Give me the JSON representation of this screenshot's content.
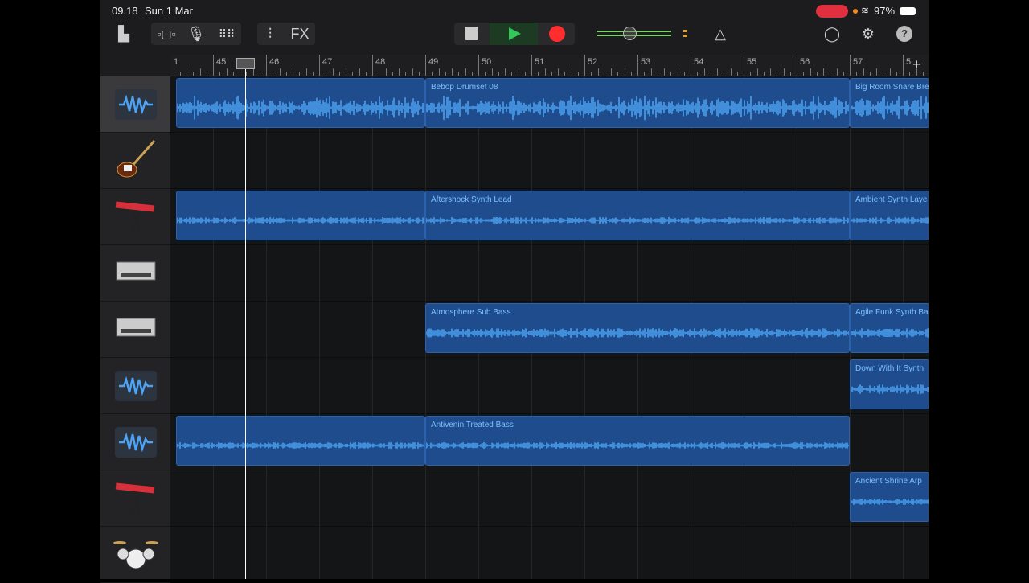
{
  "status": {
    "time": "09.18",
    "date": "Sun 1 Mar",
    "battery": "97%"
  },
  "toolbar": {
    "fx_label": "FX"
  },
  "ruler": {
    "bars": [
      "1",
      "45",
      "46",
      "47",
      "48",
      "49",
      "50",
      "51",
      "52",
      "53",
      "54",
      "55",
      "56",
      "57",
      "5"
    ],
    "add": "+"
  },
  "tracks": [
    {
      "icon": "audio-waveform-icon",
      "selected": true
    },
    {
      "icon": "electric-guitar-icon"
    },
    {
      "icon": "keyboard-icon"
    },
    {
      "icon": "drum-machine-icon"
    },
    {
      "icon": "drum-machine-icon"
    },
    {
      "icon": "audio-waveform-icon"
    },
    {
      "icon": "audio-waveform-icon"
    },
    {
      "icon": "keyboard-icon"
    },
    {
      "icon": "drum-kit-icon"
    }
  ],
  "regions": [
    {
      "track": 0,
      "start": 44.3,
      "end": 49,
      "name": ""
    },
    {
      "track": 0,
      "start": 49,
      "end": 57,
      "name": "Bebop Drumset 08"
    },
    {
      "track": 0,
      "start": 57,
      "end": 58.5,
      "name": "Big Room Snare Bre"
    },
    {
      "track": 2,
      "start": 44.3,
      "end": 49,
      "name": ""
    },
    {
      "track": 2,
      "start": 49,
      "end": 57,
      "name": "Aftershock Synth Lead"
    },
    {
      "track": 2,
      "start": 57,
      "end": 58.5,
      "name": "Ambient Synth Laye"
    },
    {
      "track": 4,
      "start": 49,
      "end": 57,
      "name": "Atmosphere Sub Bass"
    },
    {
      "track": 4,
      "start": 57,
      "end": 58.5,
      "name": "Agile Funk Synth Ba"
    },
    {
      "track": 5,
      "start": 57,
      "end": 58.5,
      "name": "Down With It Synth"
    },
    {
      "track": 6,
      "start": 44.3,
      "end": 49,
      "name": ""
    },
    {
      "track": 6,
      "start": 49,
      "end": 57,
      "name": "Antivenin Treated Bass"
    },
    {
      "track": 7,
      "start": 57,
      "end": 58.5,
      "name": "Ancient Shrine Arp"
    }
  ],
  "colors": {
    "region": "#1e4c8c",
    "waveform": "#4da3f5",
    "play": "#34c759",
    "record": "#ff2d2d"
  },
  "playhead_bar": 45.6
}
